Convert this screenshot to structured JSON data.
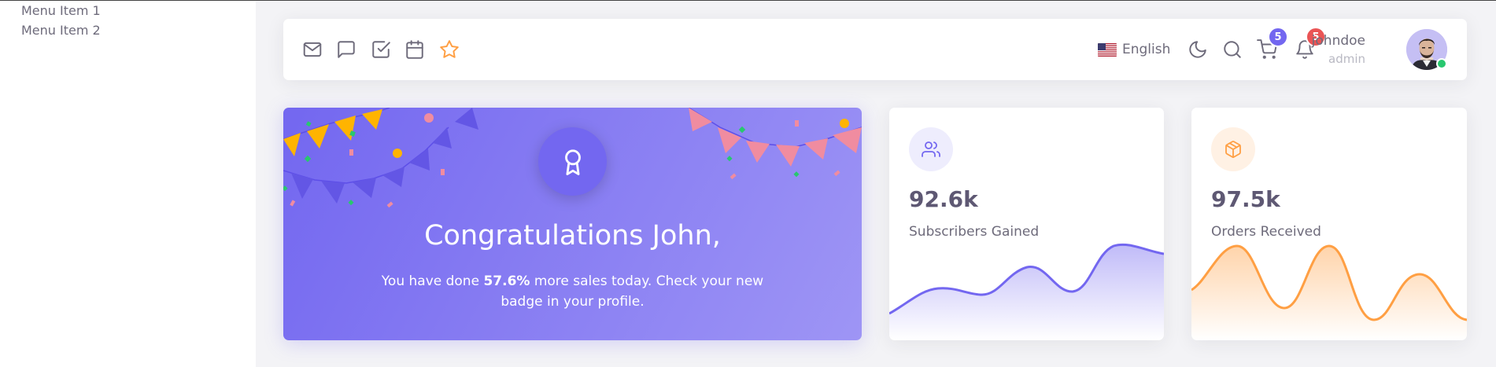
{
  "sidebar": {
    "items": [
      {
        "label": "Menu Item 1"
      },
      {
        "label": "Menu Item 2"
      }
    ]
  },
  "navbar": {
    "bookmarks": [
      {
        "icon": "mail-icon",
        "label": "Email"
      },
      {
        "icon": "chat-icon",
        "label": "Chat"
      },
      {
        "icon": "todo-icon",
        "label": "Todo"
      },
      {
        "icon": "calendar-icon",
        "label": "Calendar"
      },
      {
        "icon": "star-icon",
        "label": "Bookmark"
      }
    ],
    "language": "English",
    "cart_count": "5",
    "notification_count": "5",
    "user": {
      "name": "johndoe",
      "role": "admin"
    }
  },
  "congratulation": {
    "title": "Congratulations John,",
    "text_before": "You have done ",
    "highlight": "57.6%",
    "text_after": " more sales today. Check your new badge in your profile."
  },
  "stats": [
    {
      "value": "92.6k",
      "label": "Subscribers Gained",
      "icon": "users-icon",
      "color": "#7367f0"
    },
    {
      "value": "97.5k",
      "label": "Orders Received",
      "icon": "package-icon",
      "color": "#ff9f43"
    }
  ],
  "colors": {
    "primary": "#7367f0",
    "warning": "#ff9f43",
    "danger": "#ea5455",
    "success": "#28c76f"
  }
}
